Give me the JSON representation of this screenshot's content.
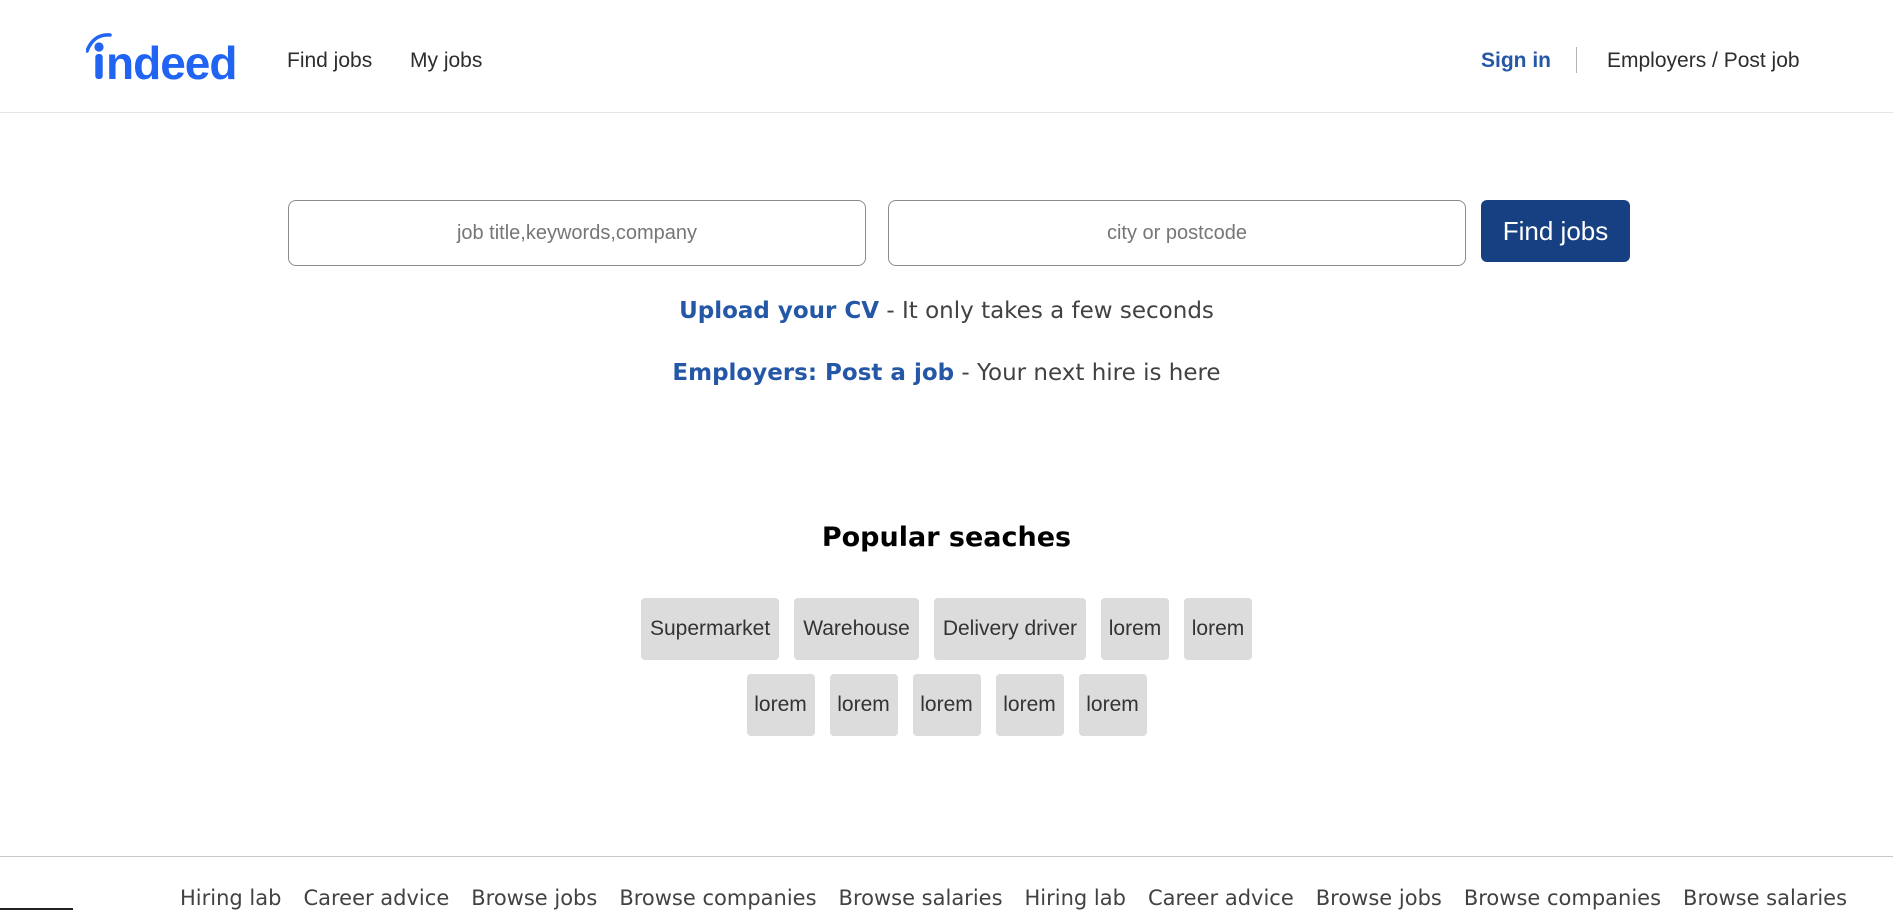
{
  "brand": {
    "logo_text": "indeed",
    "accent_color": "#2164f3",
    "link_color": "#2557a7",
    "button_color": "#164081"
  },
  "header": {
    "nav": [
      {
        "label": "Find jobs"
      },
      {
        "label": "My jobs"
      }
    ],
    "sign_in_label": "Sign in",
    "employers_label": "Employers / Post job"
  },
  "search": {
    "what_placeholder": "job title,keywords,company",
    "where_placeholder": "city or postcode",
    "button_label": "Find jobs"
  },
  "promos": [
    {
      "link": "Upload your CV",
      "text": " - It only takes a few seconds"
    },
    {
      "link": "Employers: Post a job",
      "text": " - Your next hire is here"
    }
  ],
  "popular": {
    "title": "Popular seaches",
    "row1": [
      "Supermarket",
      "Warehouse",
      "Delivery driver",
      "lorem",
      "lorem"
    ],
    "row2": [
      "lorem",
      "lorem",
      "lorem",
      "lorem",
      "lorem"
    ]
  },
  "footer": {
    "links": [
      "Hiring lab",
      "Career advice",
      "Browse jobs",
      "Browse companies",
      "Browse salaries",
      "Hiring lab",
      "Career advice",
      "Browse jobs",
      "Browse companies",
      "Browse salaries"
    ]
  }
}
